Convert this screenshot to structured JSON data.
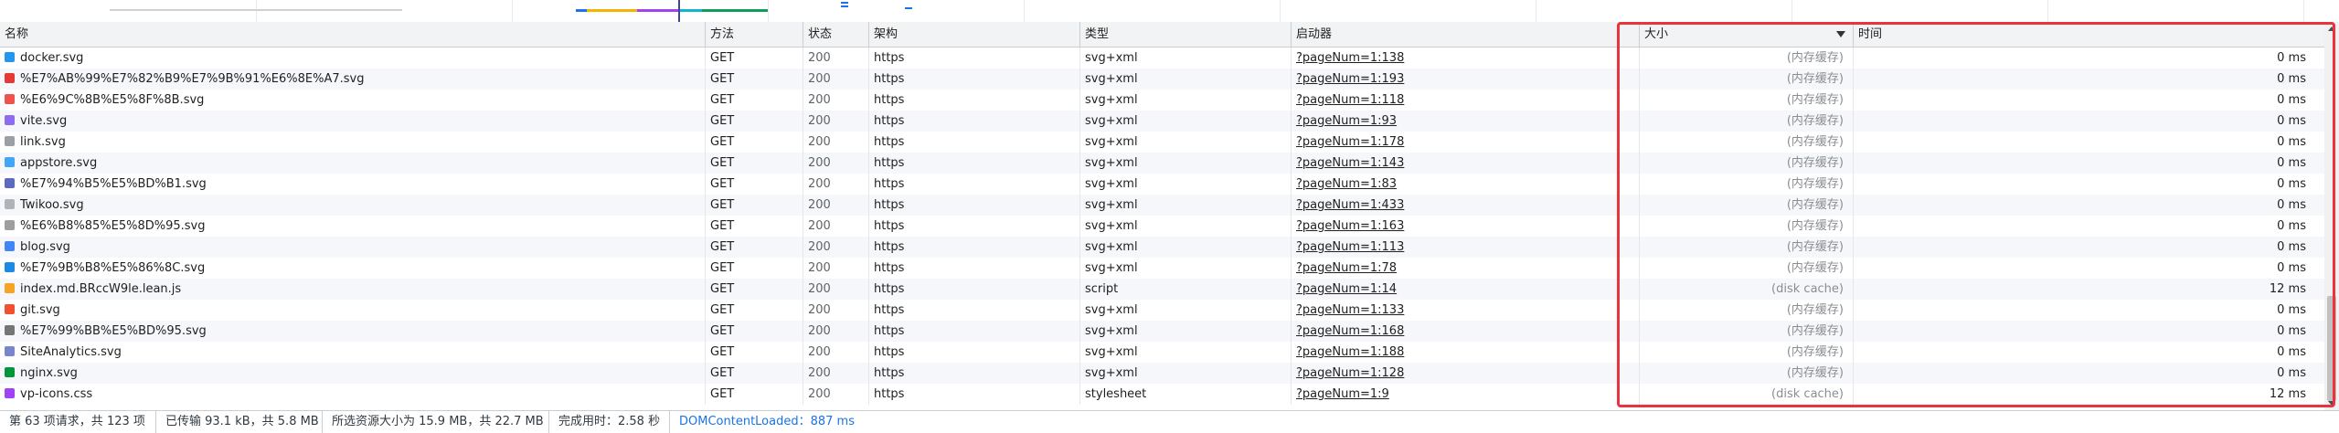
{
  "columns": {
    "name": "名称",
    "method": "方法",
    "status": "状态",
    "scheme": "架构",
    "type": "类型",
    "initiator": "启动器",
    "size": "大小",
    "time": "时间"
  },
  "rows": [
    {
      "name": "docker.svg",
      "method": "GET",
      "status": "200",
      "scheme": "https",
      "type": "svg+xml",
      "initiator": "?pageNum=1:138",
      "size": "(内存缓存)",
      "time": "0 ms",
      "icon": "docker-icon",
      "color": "#2496ed"
    },
    {
      "name": "%E7%AB%99%E7%82%B9%E7%9B%91%E6%8E%A7.svg",
      "method": "GET",
      "status": "200",
      "scheme": "https",
      "type": "svg+xml",
      "initiator": "?pageNum=1:193",
      "size": "(内存缓存)",
      "time": "0 ms",
      "icon": "monitor-icon",
      "color": "#e53935"
    },
    {
      "name": "%E6%9C%8B%E5%8F%8B.svg",
      "method": "GET",
      "status": "200",
      "scheme": "https",
      "type": "svg+xml",
      "initiator": "?pageNum=1:118",
      "size": "(内存缓存)",
      "time": "0 ms",
      "icon": "friends-icon",
      "color": "#ef5350"
    },
    {
      "name": "vite.svg",
      "method": "GET",
      "status": "200",
      "scheme": "https",
      "type": "svg+xml",
      "initiator": "?pageNum=1:93",
      "size": "(内存缓存)",
      "time": "0 ms",
      "icon": "vite-icon",
      "color": "#8e6cf0"
    },
    {
      "name": "link.svg",
      "method": "GET",
      "status": "200",
      "scheme": "https",
      "type": "svg+xml",
      "initiator": "?pageNum=1:178",
      "size": "(内存缓存)",
      "time": "0 ms",
      "icon": "link-icon",
      "color": "#9aa0a6"
    },
    {
      "name": "appstore.svg",
      "method": "GET",
      "status": "200",
      "scheme": "https",
      "type": "svg+xml",
      "initiator": "?pageNum=1:143",
      "size": "(内存缓存)",
      "time": "0 ms",
      "icon": "appstore-icon",
      "color": "#42a5f5"
    },
    {
      "name": "%E7%94%B5%E5%BD%B1.svg",
      "method": "GET",
      "status": "200",
      "scheme": "https",
      "type": "svg+xml",
      "initiator": "?pageNum=1:83",
      "size": "(内存缓存)",
      "time": "0 ms",
      "icon": "movie-icon",
      "color": "#5c6bc0"
    },
    {
      "name": "Twikoo.svg",
      "method": "GET",
      "status": "200",
      "scheme": "https",
      "type": "svg+xml",
      "initiator": "?pageNum=1:433",
      "size": "(内存缓存)",
      "time": "0 ms",
      "icon": "twikoo-icon",
      "color": "#b0b4b8"
    },
    {
      "name": "%E6%B8%85%E5%8D%95.svg",
      "method": "GET",
      "status": "200",
      "scheme": "https",
      "type": "svg+xml",
      "initiator": "?pageNum=1:163",
      "size": "(内存缓存)",
      "time": "0 ms",
      "icon": "list-icon",
      "color": "#9e9e9e"
    },
    {
      "name": "blog.svg",
      "method": "GET",
      "status": "200",
      "scheme": "https",
      "type": "svg+xml",
      "initiator": "?pageNum=1:113",
      "size": "(内存缓存)",
      "time": "0 ms",
      "icon": "blog-icon",
      "color": "#4285f4"
    },
    {
      "name": "%E7%9B%B8%E5%86%8C.svg",
      "method": "GET",
      "status": "200",
      "scheme": "https",
      "type": "svg+xml",
      "initiator": "?pageNum=1:78",
      "size": "(内存缓存)",
      "time": "0 ms",
      "icon": "album-icon",
      "color": "#1e88e5"
    },
    {
      "name": "index.md.BRccW9le.lean.js",
      "method": "GET",
      "status": "200",
      "scheme": "https",
      "type": "script",
      "initiator": "?pageNum=1:14",
      "size": "(disk cache)",
      "time": "12 ms",
      "icon": "script-icon",
      "color": "#f4a524"
    },
    {
      "name": "git.svg",
      "method": "GET",
      "status": "200",
      "scheme": "https",
      "type": "svg+xml",
      "initiator": "?pageNum=1:133",
      "size": "(内存缓存)",
      "time": "0 ms",
      "icon": "git-icon",
      "color": "#f05133"
    },
    {
      "name": "%E7%99%BB%E5%BD%95.svg",
      "method": "GET",
      "status": "200",
      "scheme": "https",
      "type": "svg+xml",
      "initiator": "?pageNum=1:168",
      "size": "(内存缓存)",
      "time": "0 ms",
      "icon": "login-icon",
      "color": "#757575"
    },
    {
      "name": "SiteAnalytics.svg",
      "method": "GET",
      "status": "200",
      "scheme": "https",
      "type": "svg+xml",
      "initiator": "?pageNum=1:188",
      "size": "(内存缓存)",
      "time": "0 ms",
      "icon": "analytics-icon",
      "color": "#7986cb"
    },
    {
      "name": "nginx.svg",
      "method": "GET",
      "status": "200",
      "scheme": "https",
      "type": "svg+xml",
      "initiator": "?pageNum=1:128",
      "size": "(内存缓存)",
      "time": "0 ms",
      "icon": "nginx-icon",
      "color": "#009639"
    },
    {
      "name": "vp-icons.css",
      "method": "GET",
      "status": "200",
      "scheme": "https",
      "type": "stylesheet",
      "initiator": "?pageNum=1:9",
      "size": "(disk cache)",
      "time": "12 ms",
      "icon": "stylesheet-icon",
      "color": "#a142f4"
    }
  ],
  "status_bar": {
    "requests": "第 63 项请求，共 123 项",
    "transferred": "已传输 93.1 kB，共 5.8 MB",
    "resources": "所选资源大小为 15.9 MB，共 22.7 MB",
    "finish": "完成用时：2.58 秒",
    "dom_content_loaded": "DOMContentLoaded：887 ms"
  },
  "colors": {
    "highlight": "#e8343e",
    "dcl": "#1a73e8"
  }
}
